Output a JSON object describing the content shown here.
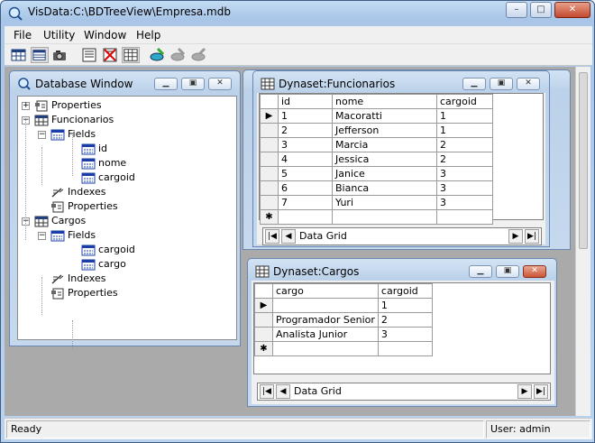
{
  "app": {
    "title": "VisData:C:\\BDTreeView\\Empresa.mdb",
    "controls": {
      "minimize": "–",
      "maximize": "□",
      "close": "✕"
    }
  },
  "menu": [
    "File",
    "Utility",
    "Window",
    "Help"
  ],
  "toolbar_icons": [
    "table-view-icon",
    "dynaset-icon",
    "snapshot-icon",
    "form-icon",
    "no-data-control-icon",
    "grid-icon",
    "begin-trans-icon",
    "commit-icon",
    "rollback-icon"
  ],
  "db_window": {
    "title": "Database Window",
    "tree": [
      {
        "label": "Properties",
        "icon": "properties-icon",
        "level": 0
      },
      {
        "label": "Funcionarios",
        "icon": "table-icon",
        "level": 0
      },
      {
        "label": "Fields",
        "icon": "fields-icon",
        "level": 1
      },
      {
        "label": "id",
        "icon": "field-icon",
        "level": 2
      },
      {
        "label": "nome",
        "icon": "field-icon",
        "level": 2
      },
      {
        "label": "cargoid",
        "icon": "field-icon",
        "level": 2
      },
      {
        "label": "Indexes",
        "icon": "indexes-icon",
        "level": 1
      },
      {
        "label": "Properties",
        "icon": "properties-icon",
        "level": 1
      },
      {
        "label": "Cargos",
        "icon": "table-icon",
        "level": 0
      },
      {
        "label": "Fields",
        "icon": "fields-icon",
        "level": 1
      },
      {
        "label": "cargoid",
        "icon": "field-icon",
        "level": 2
      },
      {
        "label": "cargo",
        "icon": "field-icon",
        "level": 2
      },
      {
        "label": "Indexes",
        "icon": "indexes-icon",
        "level": 1
      },
      {
        "label": "Properties",
        "icon": "properties-icon",
        "level": 1
      }
    ]
  },
  "funcionarios": {
    "title": "Dynaset:Funcionarios",
    "columns": [
      "id",
      "nome",
      "cargoid"
    ],
    "rows": [
      [
        "1",
        "Macoratti",
        "1"
      ],
      [
        "2",
        "Jefferson",
        "1"
      ],
      [
        "3",
        "Marcia",
        "2"
      ],
      [
        "4",
        "Jessica",
        "2"
      ],
      [
        "5",
        "Janice",
        "3"
      ],
      [
        "6",
        "Bianca",
        "3"
      ],
      [
        "7",
        "Yuri",
        "3"
      ]
    ],
    "nav_label": "Data Grid"
  },
  "cargos": {
    "title": "Dynaset:Cargos",
    "columns": [
      "cargo",
      "cargoid"
    ],
    "rows": [
      [
        "",
        "1"
      ],
      [
        "Programador Senior",
        "2"
      ],
      [
        "Analista Junior",
        "3"
      ]
    ],
    "nav_label": "Data Grid"
  },
  "status": {
    "left": "Ready",
    "right": "User: admin"
  },
  "colors": {
    "accent": "#3c5c86",
    "mdi_background": "#aaaaaa"
  }
}
